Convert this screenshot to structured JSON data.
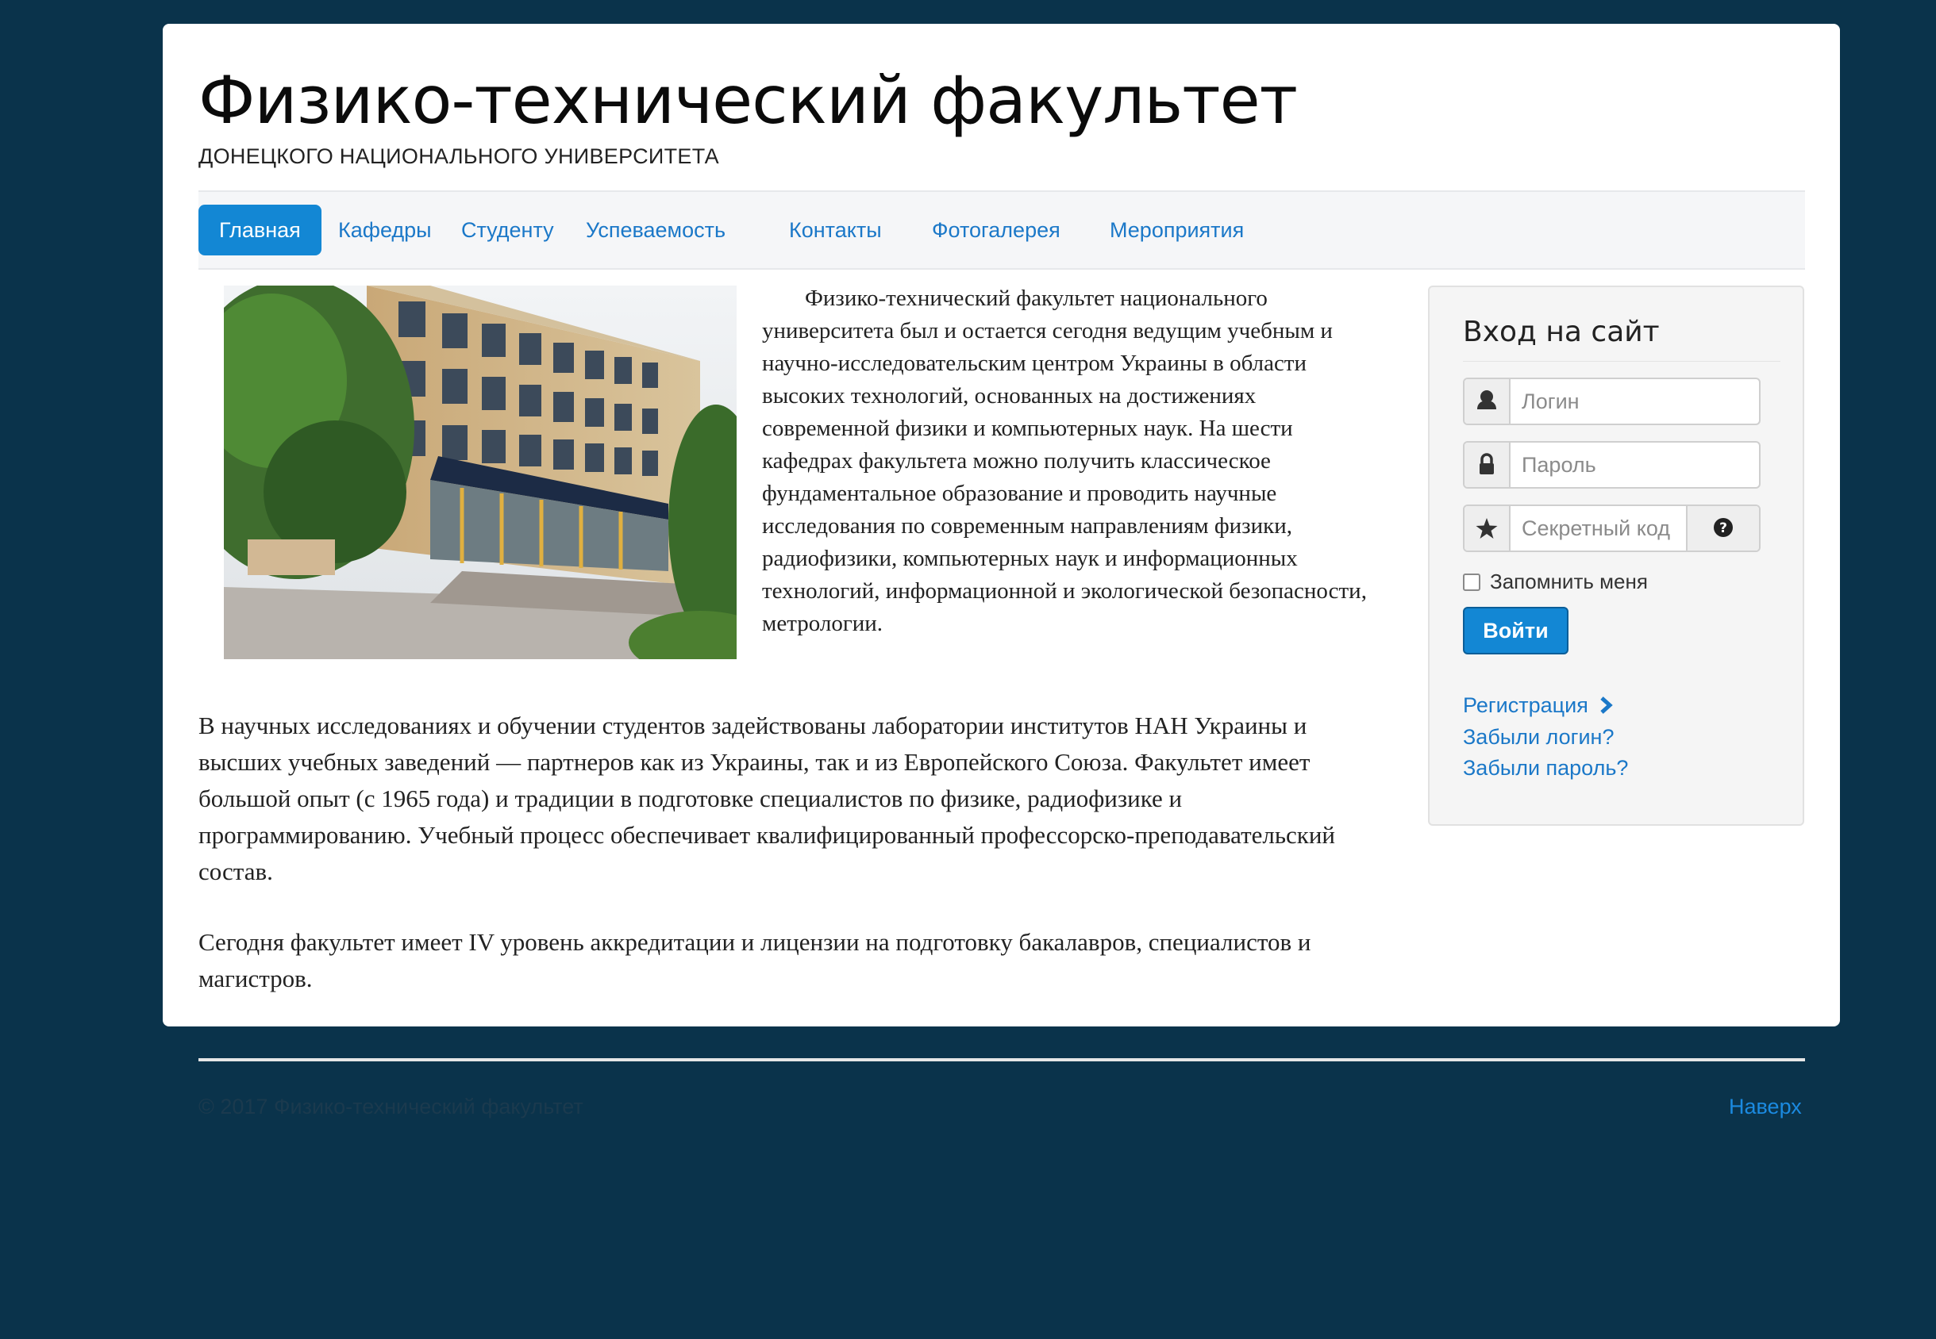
{
  "header": {
    "title": "Физико-технический факультет",
    "subtitle": "ДОНЕЦКОГО НАЦИОНАЛЬНОГО УНИВЕРСИТЕТА"
  },
  "nav": {
    "items": [
      {
        "label": "Главная",
        "active": true
      },
      {
        "label": "Кафедры"
      },
      {
        "label": "Студенту"
      },
      {
        "label": "Успеваемость"
      },
      {
        "label": "Контакты"
      },
      {
        "label": "Фотогалерея"
      },
      {
        "label": "Мероприятия"
      }
    ]
  },
  "content": {
    "intro": "Физико-технический факультет национального университета был и остается сегодня ведущим учебным и научно-исследовательским центром Украины в области высоких технологий, основанных на достижениях современной физики и компьютерных наук. На шести кафедрах факультета можно получить классическое фундаментальное образование и проводить научные исследования по современным направлениям физики, радиофизики, компьютерных наук и информационных технологий, информационной и экологической безопасности, метрологии.",
    "paragraph2": "В научных исследованиях и обучении студентов задействованы лаборатории институтов НАН Украины и высших учебных заведений — партнеров как из Украины, так и из Европейского Союза. Факультет имеет большой опыт (с 1965 года) и традиции в подготовке специалистов по физике, радиофизике и программированию. Учебный процесс обеспечивает квалифицированный профессорско-преподавательский состав.",
    "paragraph3": "Сегодня факультет имеет IV уровень аккредитации и лицензии на подготовку бакалавров, специалистов и магистров."
  },
  "login": {
    "title": "Вход на сайт",
    "username_placeholder": "Логин",
    "password_placeholder": "Пароль",
    "secret_placeholder": "Секретный код",
    "remember_label": "Запомнить меня",
    "submit_label": "Войти",
    "register_link": "Регистрация",
    "forgot_login_link": "Забыли логин?",
    "forgot_password_link": "Забыли пароль?"
  },
  "footer": {
    "copyright": "© 2017 Физико-технический факультет",
    "back_to_top": "Наверх"
  },
  "icons": {
    "username": "user-icon",
    "password": "lock-icon",
    "secret": "star-icon",
    "help": "question-circle-icon",
    "register": "chevron-right-icon"
  },
  "colors": {
    "background": "#0a334b",
    "accent": "#1387d4",
    "link": "#1b78c8"
  }
}
